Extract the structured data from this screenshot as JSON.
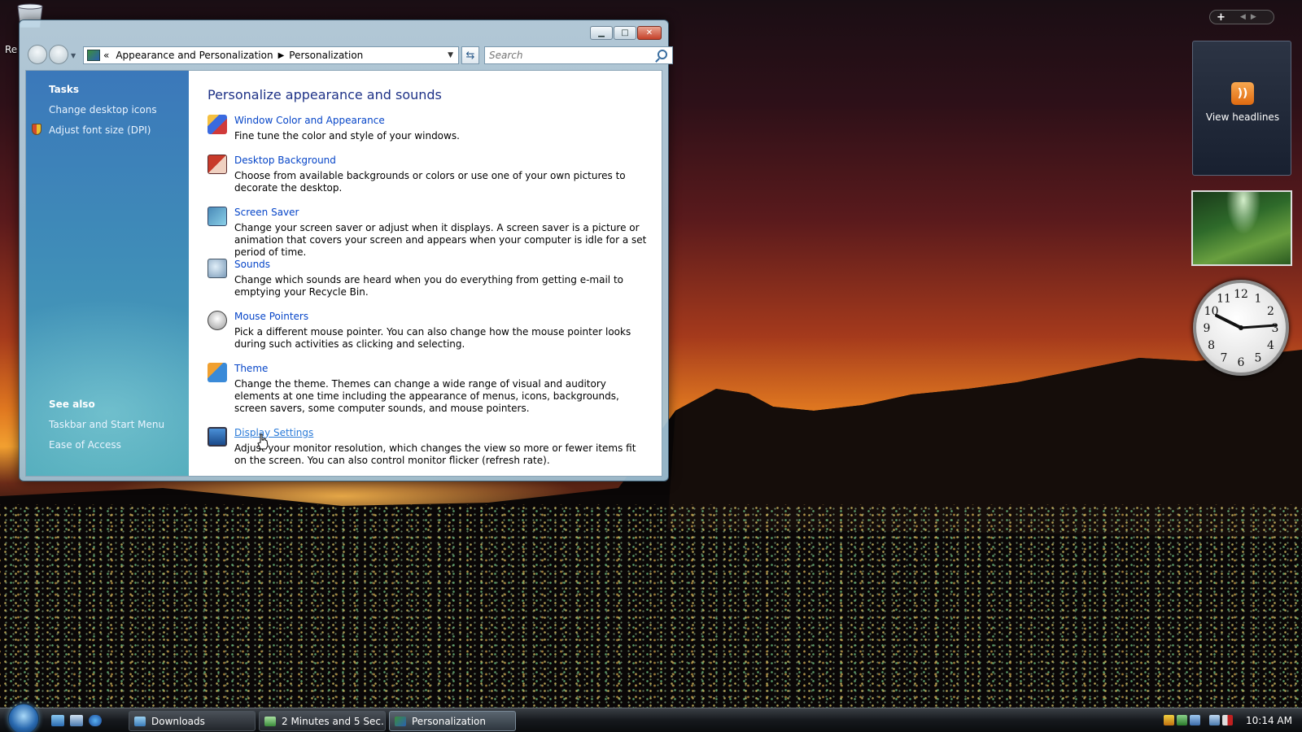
{
  "desktop": {
    "recycle_bin_label": "Re"
  },
  "window": {
    "breadcrumb": {
      "prefix": "«",
      "parent": "Appearance and Personalization",
      "current": "Personalization"
    },
    "search_placeholder": "Search",
    "sidebar": {
      "tasks_heading": "Tasks",
      "tasks": [
        "Change desktop icons",
        "Adjust font size (DPI)"
      ],
      "see_also_heading": "See also",
      "see_also": [
        "Taskbar and Start Menu",
        "Ease of Access"
      ]
    },
    "main_title": "Personalize appearance and sounds",
    "items": [
      {
        "title": "Window Color and Appearance",
        "desc": "Fine tune the color and style of your windows.",
        "icon": "window-color-icon"
      },
      {
        "title": "Desktop Background",
        "desc": "Choose from available backgrounds or colors or use one of your own pictures to decorate the desktop.",
        "icon": "desktop-background-icon"
      },
      {
        "title": "Screen Saver",
        "desc": "Change your screen saver or adjust when it displays. A screen saver is a picture or animation that covers your screen and appears when your computer is idle for a set period of time.",
        "icon": "screen-saver-icon"
      },
      {
        "title": "Sounds",
        "desc": "Change which sounds are heard when you do everything from getting e-mail to emptying your Recycle Bin.",
        "icon": "sounds-icon"
      },
      {
        "title": "Mouse Pointers",
        "desc": "Pick a different mouse pointer. You can also change how the mouse pointer looks during such activities as clicking and selecting.",
        "icon": "mouse-pointers-icon"
      },
      {
        "title": "Theme",
        "desc": "Change the theme. Themes can change a wide range of visual and auditory elements at one time including the appearance of menus, icons, backgrounds, screen savers, some computer sounds, and mouse pointers.",
        "icon": "theme-icon"
      },
      {
        "title": "Display Settings",
        "desc": "Adjust your monitor resolution, which changes the view so more or fewer items fit on the screen. You can also control monitor flicker (refresh rate).",
        "icon": "display-settings-icon"
      }
    ]
  },
  "gadgets": {
    "plus": "+",
    "feed_label": "View headlines",
    "clock_numbers": [
      "12",
      "1",
      "2",
      "3",
      "4",
      "5",
      "6",
      "7",
      "8",
      "9",
      "10",
      "11"
    ]
  },
  "taskbar": {
    "buttons": [
      "Downloads",
      "2 Minutes and 5 Sec...",
      "Personalization"
    ],
    "clock": "10:14 AM"
  }
}
